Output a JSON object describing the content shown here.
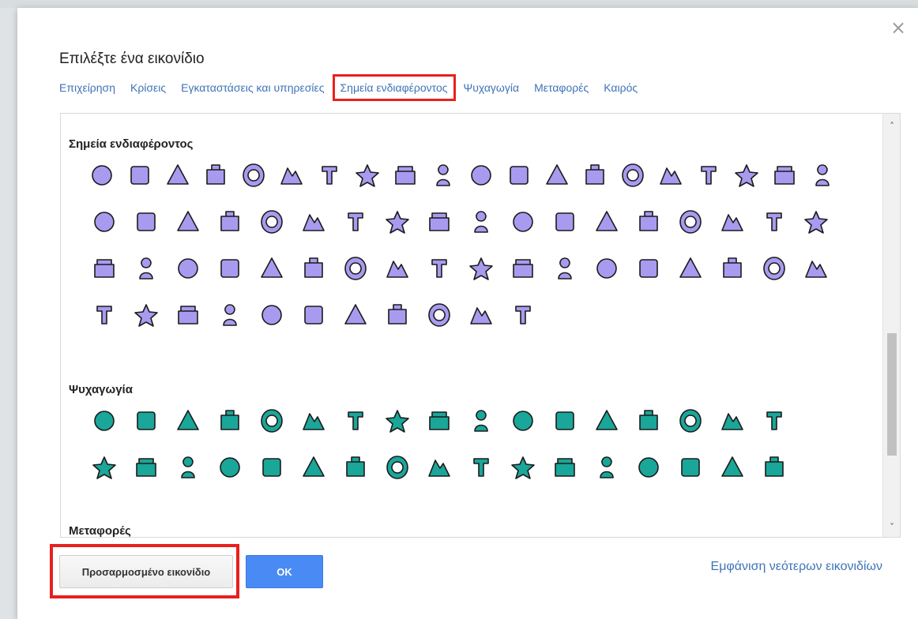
{
  "dialog": {
    "title": "Επιλέξτε ένα εικονίδιο",
    "close_symbol": "×",
    "tabs": [
      {
        "label": "Επιχείρηση",
        "active": false
      },
      {
        "label": "Κρίσεις",
        "active": false
      },
      {
        "label": "Εγκαταστάσεις και υπηρεσίες",
        "active": false
      },
      {
        "label": "Σημεία ενδιαφέροντος",
        "active": true
      },
      {
        "label": "Ψυχαγωγία",
        "active": false
      },
      {
        "label": "Μεταφορές",
        "active": false
      },
      {
        "label": "Καιρός",
        "active": false
      }
    ],
    "sections": [
      {
        "title": "Σημεία ενδιαφέροντος",
        "color": "#a89bef",
        "icon_names": [
          "ant-icon",
          "flower-cluster-icon",
          "palette-icon",
          "paw-icon",
          "barn-icon",
          "gate-icon",
          "dice-icon",
          "forest-icon",
          "museum-icon",
          "town-hall-icon",
          "hammer-icon",
          "fish-icon",
          "police-badge-icon",
          "circle-rock-icon",
          "chat-icon",
          "factory-icon",
          "fountain-icon",
          "flower-icon",
          "house-icon",
          "flag-icon",
          "leaf-icon",
          "castle-icon",
          "monument-icon",
          "bucket-icon",
          "ambulance-icon",
          "cross-icon",
          "bridge-icon",
          "beam-icon",
          "blocks-icon",
          "gateway-icon",
          "book-icon",
          "lighthouse-icon",
          "binoculars-icon",
          "tower-icon",
          "tree-icon",
          "museum-m-icon",
          "piano-icon",
          "music-icon",
          "heart-hands-icon",
          "swing-icon",
          "car-icon",
          "potion-icon",
          "envelope-icon",
          "fence-icon",
          "burst-icon",
          "snowflake-icon",
          "swastika-icon",
          "wheel-icon",
          "ring-icon",
          "christian-cross-icon",
          "temple-icon",
          "om-icon",
          "crescent-icon",
          "hand-icon",
          "star-of-david-icon",
          "praying-icon",
          "torii-icon",
          "peace-icon",
          "couple-icon",
          "tent-icon",
          "pyramid-icon",
          "stupa-icon",
          "theater-icon",
          "eiffel-icon",
          "radio-icon",
          "graduation-cap-icon",
          "elephant-icon"
        ]
      },
      {
        "title": "Ψυχαγωγία",
        "color": "#1aa698",
        "icon_names": [
          "tennis-icon",
          "basketball-icon",
          "parasol-icon",
          "bowling-icon",
          "rowing-icon",
          "cricket-icon",
          "fish-entertain-icon",
          "football-icon",
          "golf-icon",
          "hiking-icon",
          "group-hiking-icon",
          "horse-icon",
          "swim-wave-icon",
          "mountain-icon",
          "tree-entertain-icon",
          "picnic-icon",
          "playground-icon",
          "racing-flag-icon",
          "sailboat-icon",
          "running-icon",
          "waves-icon",
          "swimming-pool-icon",
          "swimmer-icon",
          "search-magnifier-icon",
          "binoculars-entertain-icon",
          "watchtower-icon",
          "shell-icon",
          "pinwheel-icon",
          "flower-burst-icon",
          "skiing-icon",
          "snowboard-icon",
          "sledding-icon",
          "skating-icon",
          "snowflake-entertain-icon"
        ]
      },
      {
        "title": "Μεταφορές",
        "color": "#1aa698",
        "icon_names": []
      }
    ],
    "buttons": {
      "custom_icon": "Προσαρμοσμένο εικονίδιο",
      "ok": "OK",
      "more_icons": "Εμφάνιση νεότερων εικονιδίων"
    },
    "scroll": {
      "up_symbol": "˄",
      "down_symbol": "˅"
    }
  }
}
